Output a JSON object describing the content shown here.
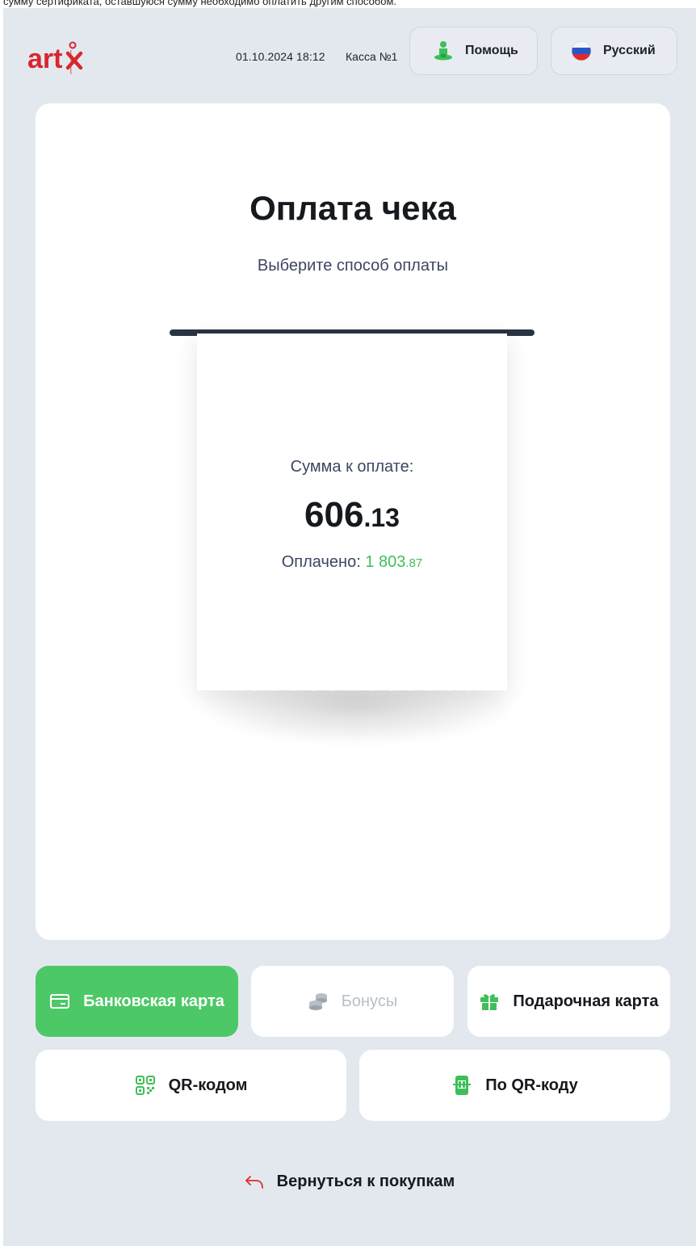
{
  "top_note": "сумму сертификата, оставшуюся сумму необходимо оплатить другим способом.",
  "header": {
    "datetime": "01.10.2024 18:12",
    "register": "Касса №1",
    "help_label": "Помощь",
    "language_label": "Русский"
  },
  "main": {
    "title": "Оплата чека",
    "subtitle": "Выберите способ оплаты",
    "receipt": {
      "amount_label": "Сумма к оплате:",
      "amount_int": "606",
      "amount_frac": ".13",
      "paid_label": "Оплачено: ",
      "paid_int": "1 803",
      "paid_frac": ".87"
    }
  },
  "payment_methods": {
    "bank_card": "Банковская карта",
    "bonuses": "Бонусы",
    "gift_card": "Подарочная карта",
    "qr_code": "QR-кодом",
    "by_qr_code": "По QR-коду"
  },
  "back_label": "Вернуться к покупкам",
  "colors": {
    "accent_green": "#4cc866",
    "paid_green": "#3fbf5a",
    "background": "#e3e8ef",
    "brand_red": "#d9262d",
    "disabled_text": "#b7bec8"
  },
  "icons": {
    "help": "person-help-icon",
    "language": "russian-flag-icon",
    "bank_card": "credit-card-icon",
    "bonuses": "coins-icon",
    "gift_card": "gift-icon",
    "qr_code": "qr-code-icon",
    "by_qr_code": "phone-qr-icon",
    "back": "return-arrow-icon"
  }
}
